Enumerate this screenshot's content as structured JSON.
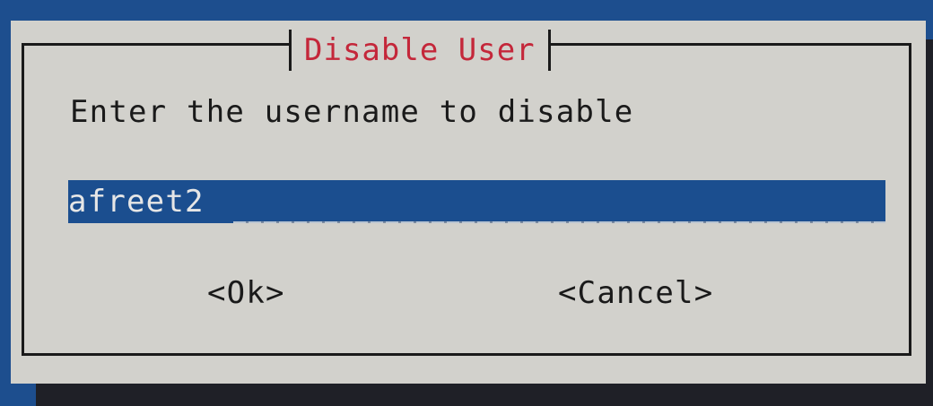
{
  "dialog": {
    "title": "Disable User",
    "prompt": "Enter the username to disable",
    "input_value": "afreet2",
    "ok_label": "<Ok>",
    "cancel_label": "<Cancel>"
  },
  "colors": {
    "background": "#1d4e8e",
    "dialog_bg": "#d2d1cc",
    "title": "#c4273a",
    "text": "#1a1a1a",
    "input_bg": "#1b4e8f",
    "input_text": "#e6e6e6",
    "shadow": "#1f2027"
  }
}
